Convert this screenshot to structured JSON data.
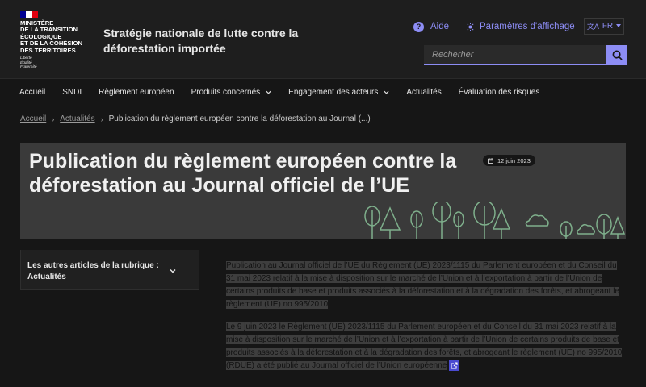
{
  "header": {
    "ministry_lines": [
      "Ministère",
      "de la transition",
      "écologique",
      "et de la cohésion",
      "des territoires"
    ],
    "motto_lines": [
      "Liberté",
      "Égalité",
      "Fraternité"
    ],
    "site_title": "Stratégie nationale de lutte contre la déforestation importée",
    "tools": {
      "aide": "Aide",
      "params": "Paramètres d'affichage",
      "lang": "FR"
    },
    "search_placeholder": "Recherher"
  },
  "nav": {
    "items": [
      {
        "label": "Accueil"
      },
      {
        "label": "SNDI"
      },
      {
        "label": "Règlement européen"
      },
      {
        "label": "Produits concernés"
      },
      {
        "label": "Engagement des acteurs"
      },
      {
        "label": "Actualités"
      },
      {
        "label": "Évaluation des risques"
      }
    ]
  },
  "breadcrumb": {
    "home": "Accueil",
    "section": "Actualités",
    "current": "Publication du règlement européen contre la déforestation au Journal (...)"
  },
  "hero": {
    "title": "Publication du règlement européen contre la déforestation au Journal officiel de l’UE",
    "date": "12 juin 2023"
  },
  "side_menu": {
    "label": "Les autres articles de la rubrique : Actualités"
  },
  "article": {
    "paragraphs": [
      "Publication au Journal officiel de l’UE du Règlement (UE) 2023/1115 du Parlement européen et du Conseil du 31 mai 2023 relatif à la mise à disposition sur le marché de l’Union et à l’exportation à partir de l’Union de certains produits de base et produits associés à la déforestation et à la dégradation des forêts, et abrogeant le règlement (UE) no 995/2010",
      "Le 9 juin 2023 le Règlement (UE) 2023/1115 du Parlement européen et du Conseil du 31 mai 2023 relatif à la mise à disposition sur le marché de l’Union et à l’exportation à partir de l’Union de certains produits de base et produits associés à la déforestation et à la dégradation des forêts, et abrogeant le règlement (UE) no 995/2010 (RDUE) a été publié au Journal officiel de l’Union européenne"
    ]
  },
  "colors": {
    "accent": "#8d8df5",
    "flag_blue": "#000091",
    "flag_red": "#e1000f"
  },
  "icons": [
    "question-icon",
    "sun-icon",
    "translate-icon",
    "search-icon",
    "chevron-down-icon",
    "calendar-icon",
    "external-link-icon"
  ]
}
